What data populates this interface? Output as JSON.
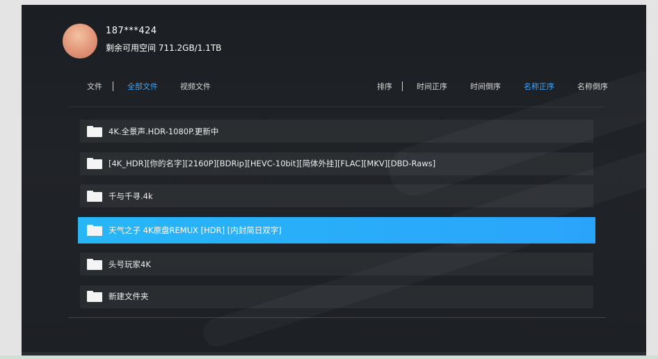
{
  "user": {
    "name": "187***424",
    "storage": "剩余可用空间 711.2GB/1.1TB"
  },
  "tabs": [
    {
      "label": "文件",
      "active": false
    },
    {
      "label": "全部文件",
      "active": true
    },
    {
      "label": "视频文件",
      "active": false
    }
  ],
  "sort": {
    "label": "排序",
    "options": [
      {
        "label": "时间正序",
        "active": false
      },
      {
        "label": "时间倒序",
        "active": false
      },
      {
        "label": "名称正序",
        "active": true
      },
      {
        "label": "名称倒序",
        "active": false
      }
    ]
  },
  "files": [
    {
      "name": "4K.全景声.HDR-1080P.更新中",
      "icon": "folder-icon",
      "selected": false
    },
    {
      "name": "[4K_HDR][你的名字][2160P][BDRip][HEVC-10bit][简体外挂][FLAC][MKV][DBD-Raws]",
      "icon": "folder-icon",
      "selected": false
    },
    {
      "name": "千与千寻.4k",
      "icon": "folder-icon",
      "selected": false
    },
    {
      "name": "天气之子 4K原盘REMUX [HDR] [内封简日双字]",
      "icon": "folder-icon",
      "selected": true
    },
    {
      "name": "头号玩家4K",
      "icon": "folder-icon",
      "selected": false
    },
    {
      "name": "新建文件夹",
      "icon": "folder-icon",
      "selected": false
    }
  ],
  "colors": {
    "accent": "#3aa6ff",
    "selection": "#28b6f7",
    "background": "#1d2024"
  }
}
